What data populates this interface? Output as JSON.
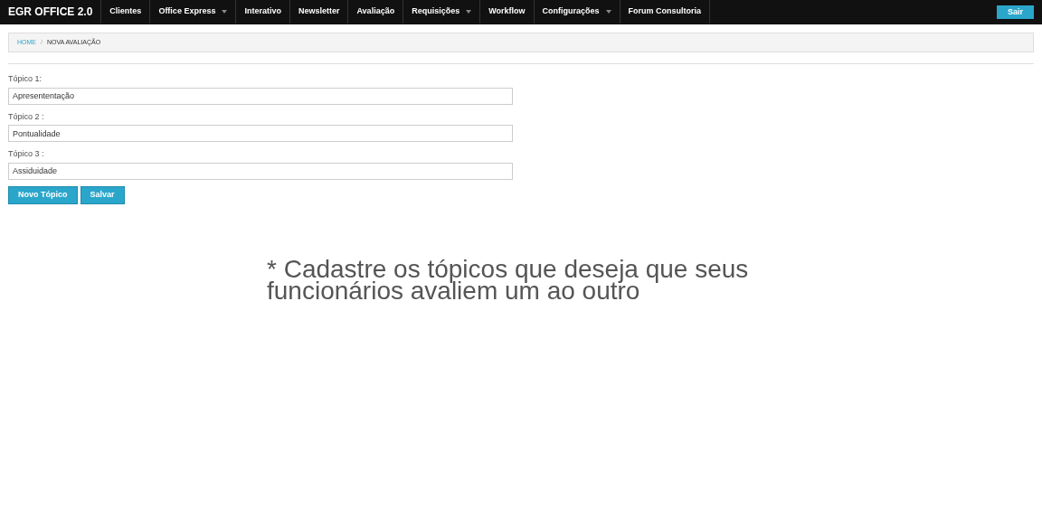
{
  "navbar": {
    "brand": "EGR OFFICE 2.0",
    "items": [
      {
        "label": "Clientes",
        "dropdown": false
      },
      {
        "label": "Office Express",
        "dropdown": true
      },
      {
        "label": "Interativo",
        "dropdown": false
      },
      {
        "label": "Newsletter",
        "dropdown": false
      },
      {
        "label": "Avaliação",
        "dropdown": false
      },
      {
        "label": "Requisições",
        "dropdown": true
      },
      {
        "label": "Workflow",
        "dropdown": false
      },
      {
        "label": "Configurações",
        "dropdown": true
      },
      {
        "label": "Forum Consultoria",
        "dropdown": false
      }
    ],
    "logout": "Sair"
  },
  "breadcrumb": {
    "home": "HOME",
    "separator": "/",
    "current": "NOVA AVALIAÇÃO"
  },
  "form": {
    "fields": [
      {
        "label": "Tópico 1:",
        "value": "Apresententação"
      },
      {
        "label": "Tópico 2 :",
        "value": "Pontualidade"
      },
      {
        "label": "Tópico 3 :",
        "value": "Assiduidade"
      }
    ],
    "buttons": [
      "Novo Tópico",
      "Salvar"
    ]
  },
  "note": "* Cadastre os tópicos que deseja que seus funcionários avaliem um ao outro"
}
